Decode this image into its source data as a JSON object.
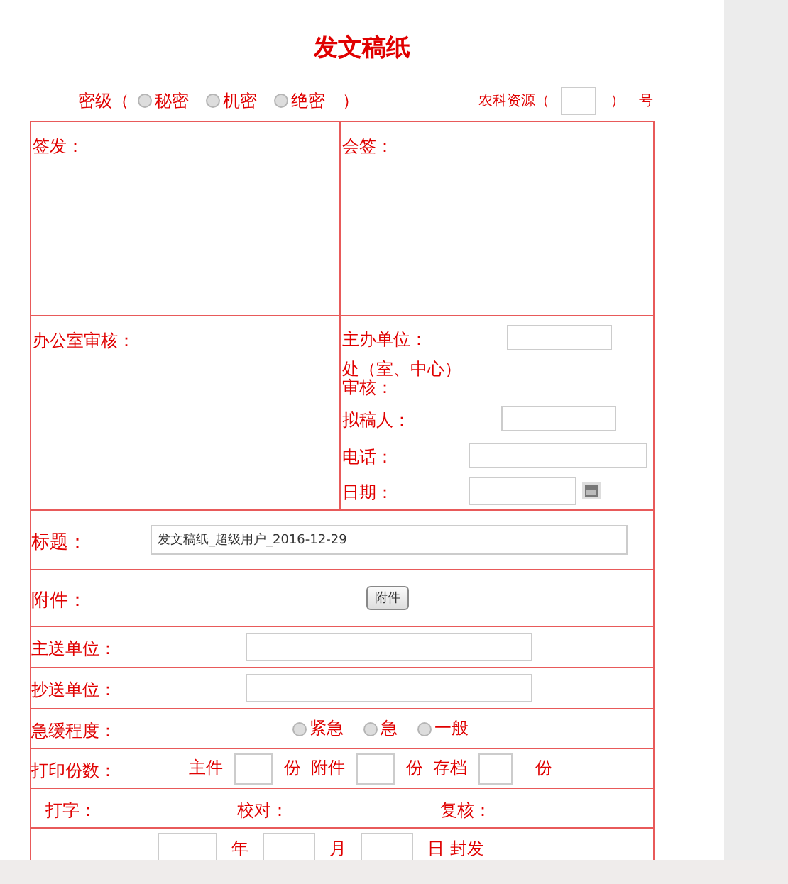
{
  "title": "发文稿纸",
  "classification": {
    "label": "密级（",
    "options": [
      {
        "label": "秘密",
        "selected": false
      },
      {
        "label": "机密",
        "selected": false
      },
      {
        "label": "绝密",
        "selected": false
      }
    ],
    "close": "）"
  },
  "serial": {
    "prefix": "农科资源（",
    "close": "）",
    "suffix": "号"
  },
  "sign_cells": [
    {
      "label": "签发："
    },
    {
      "label": "会签："
    }
  ],
  "office_review": {
    "label": "办公室审核："
  },
  "details": [
    {
      "label": "主办单位：",
      "kind": "field"
    },
    {
      "label": "处（室、中心）审核：",
      "kind": "text"
    },
    {
      "label": "拟稿人：",
      "kind": "field"
    },
    {
      "label": "电话：",
      "kind": "field"
    },
    {
      "label": "日期：",
      "kind": "date"
    }
  ],
  "subject": {
    "label": "标题：",
    "value": "发文稿纸_超级用户_2016-12-29"
  },
  "attachment": {
    "label": "附件：",
    "button": "附件"
  },
  "recipients": [
    {
      "label": "主送单位："
    },
    {
      "label": "抄送单位："
    }
  ],
  "urgency": {
    "label": "急缓程度：",
    "options": [
      {
        "label": "紧急",
        "selected": false
      },
      {
        "label": "急",
        "selected": false
      },
      {
        "label": "一般",
        "selected": false
      }
    ]
  },
  "copies": {
    "label": "打印份数：",
    "items": [
      {
        "label": "主件",
        "unit": "份"
      },
      {
        "label": "附件",
        "unit": "份"
      },
      {
        "label": "存档",
        "unit": "份"
      }
    ]
  },
  "signers": [
    "打字：",
    "校对：",
    "复核："
  ],
  "seal_date": {
    "parts": [
      "年",
      "月",
      "日 封发"
    ]
  }
}
